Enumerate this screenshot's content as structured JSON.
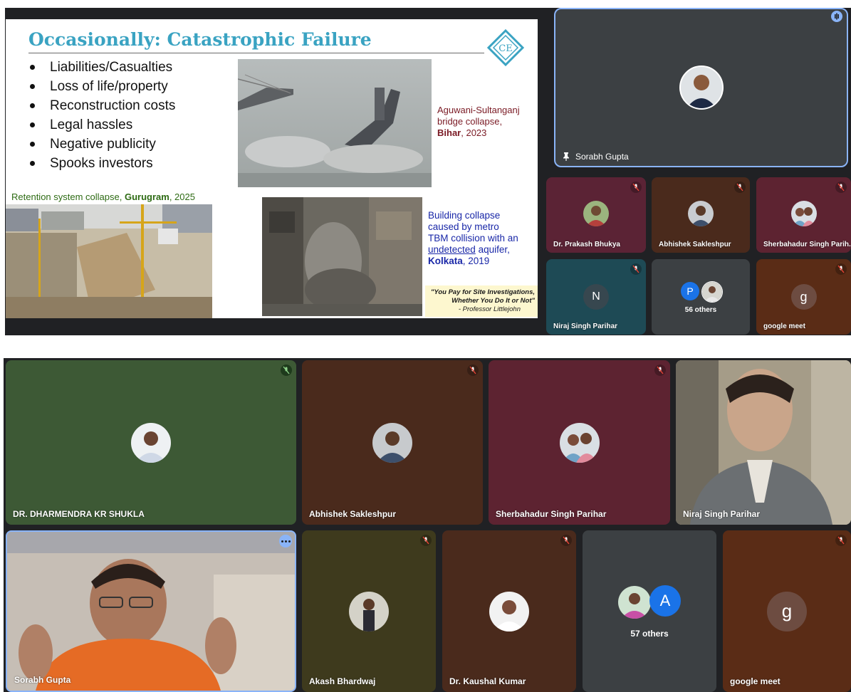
{
  "slide": {
    "title": "Occasionally: Catastrophic Failure",
    "bullets": [
      "Liabilities/Casualties",
      "Loss of life/property",
      "Reconstruction costs",
      "Legal hassles",
      "Negative publicity",
      "Spooks investors"
    ],
    "bridge_caption_line1": "Aguwani-Sultanganj",
    "bridge_caption_line2": "bridge collapse,",
    "bridge_caption_place": "Bihar",
    "bridge_caption_year": ", 2023",
    "retention_caption_prefix": "Retention system collapse, ",
    "retention_caption_place": "Gurugram",
    "retention_caption_year": ", 2025",
    "building_caption_line1": "Building collapse",
    "building_caption_line2": "caused by metro",
    "building_caption_line3": "TBM collision with an",
    "building_caption_underlined": "undetected",
    "building_caption_line4_rest": " aquifer,",
    "building_caption_place": "Kolkata",
    "building_caption_year": ", 2019",
    "quote_line1": "\"You Pay for Site Investigations,",
    "quote_line2": "Whether You Do It or Not\"",
    "quote_author": "- Professor Littlejohn"
  },
  "top_grid": {
    "pinned": {
      "name": "Sorabh Gupta"
    },
    "tiles": [
      {
        "name": "Dr. Prakash Bhukya",
        "color": "#5b2335"
      },
      {
        "name": "Abhishek Sakleshpur",
        "color": "#4a2a1c"
      },
      {
        "name": "Sherbahadur Singh Parih...",
        "color": "#5d2331"
      },
      {
        "name": "Niraj Singh Parihar",
        "letter": "N",
        "color": "#1e4a55"
      },
      {
        "name": "",
        "others_letter": "P",
        "others_label": "56 others",
        "color": "#3c4043"
      },
      {
        "name": "google meet",
        "letter": "g",
        "color": "#5a2c16"
      }
    ]
  },
  "bottom_grid": {
    "row1": [
      {
        "name": "DR. DHARMENDRA KR SHUKLA",
        "color": "#3d5935"
      },
      {
        "name": "Abhishek Sakleshpur",
        "color": "#4a2a1c"
      },
      {
        "name": "Sherbahadur Singh Parihar",
        "color": "#5d2331"
      },
      {
        "name": "Niraj Singh Parihar",
        "color": "#8a8270"
      }
    ],
    "row2": [
      {
        "name": "Sorabh Gupta",
        "color": "#c9c2ba"
      },
      {
        "name": "Akash Bhardwaj",
        "color": "#3e3a1d"
      },
      {
        "name": "Dr. Kaushal Kumar",
        "color": "#4a2a1c"
      },
      {
        "name": "",
        "others_letter": "A",
        "others_label": "57 others",
        "color": "#3c4043"
      },
      {
        "name": "google meet",
        "letter": "g",
        "color": "#5a2c16"
      }
    ]
  },
  "colors": {
    "accent_blue": "#1a73e8",
    "meet_bg": "#202124",
    "pin_border": "#8ab4f8"
  }
}
